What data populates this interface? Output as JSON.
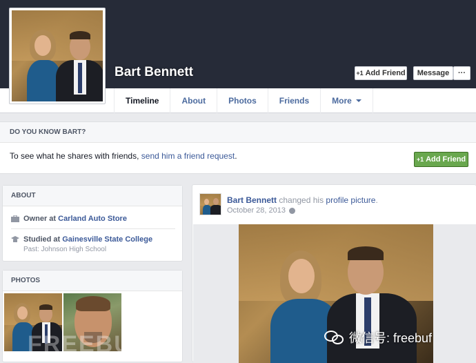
{
  "profile": {
    "name": "Bart Bennett",
    "add_friend_label": "Add Friend",
    "message_label": "Message",
    "more_dots": "···"
  },
  "tabs": [
    {
      "label": "Timeline"
    },
    {
      "label": "About"
    },
    {
      "label": "Photos"
    },
    {
      "label": "Friends"
    },
    {
      "label": "More"
    }
  ],
  "know_card": {
    "heading": "DO YOU KNOW BART?",
    "text_before": "To see what he shares with friends, ",
    "link_text": "send him a friend request",
    "text_after": ".",
    "button_label": "Add Friend"
  },
  "about_card": {
    "heading": "ABOUT",
    "work_prefix": "Owner at ",
    "work_place": "Carland Auto Store",
    "study_prefix": "Studied at ",
    "study_place": "Gainesville State College",
    "past_school": "Past: Johnson High School"
  },
  "photos_card": {
    "heading": "PHOTOS"
  },
  "post": {
    "author": "Bart Bennett",
    "action": " changed his ",
    "link": "profile picture",
    "end": ".",
    "date": "October 28, 2013"
  },
  "watermark": {
    "text": "微信号: freebuf",
    "faint": "FREEBUF"
  },
  "colors": {
    "cover": "#262b38",
    "link": "#3b5998",
    "green_button": "#69a74e"
  }
}
